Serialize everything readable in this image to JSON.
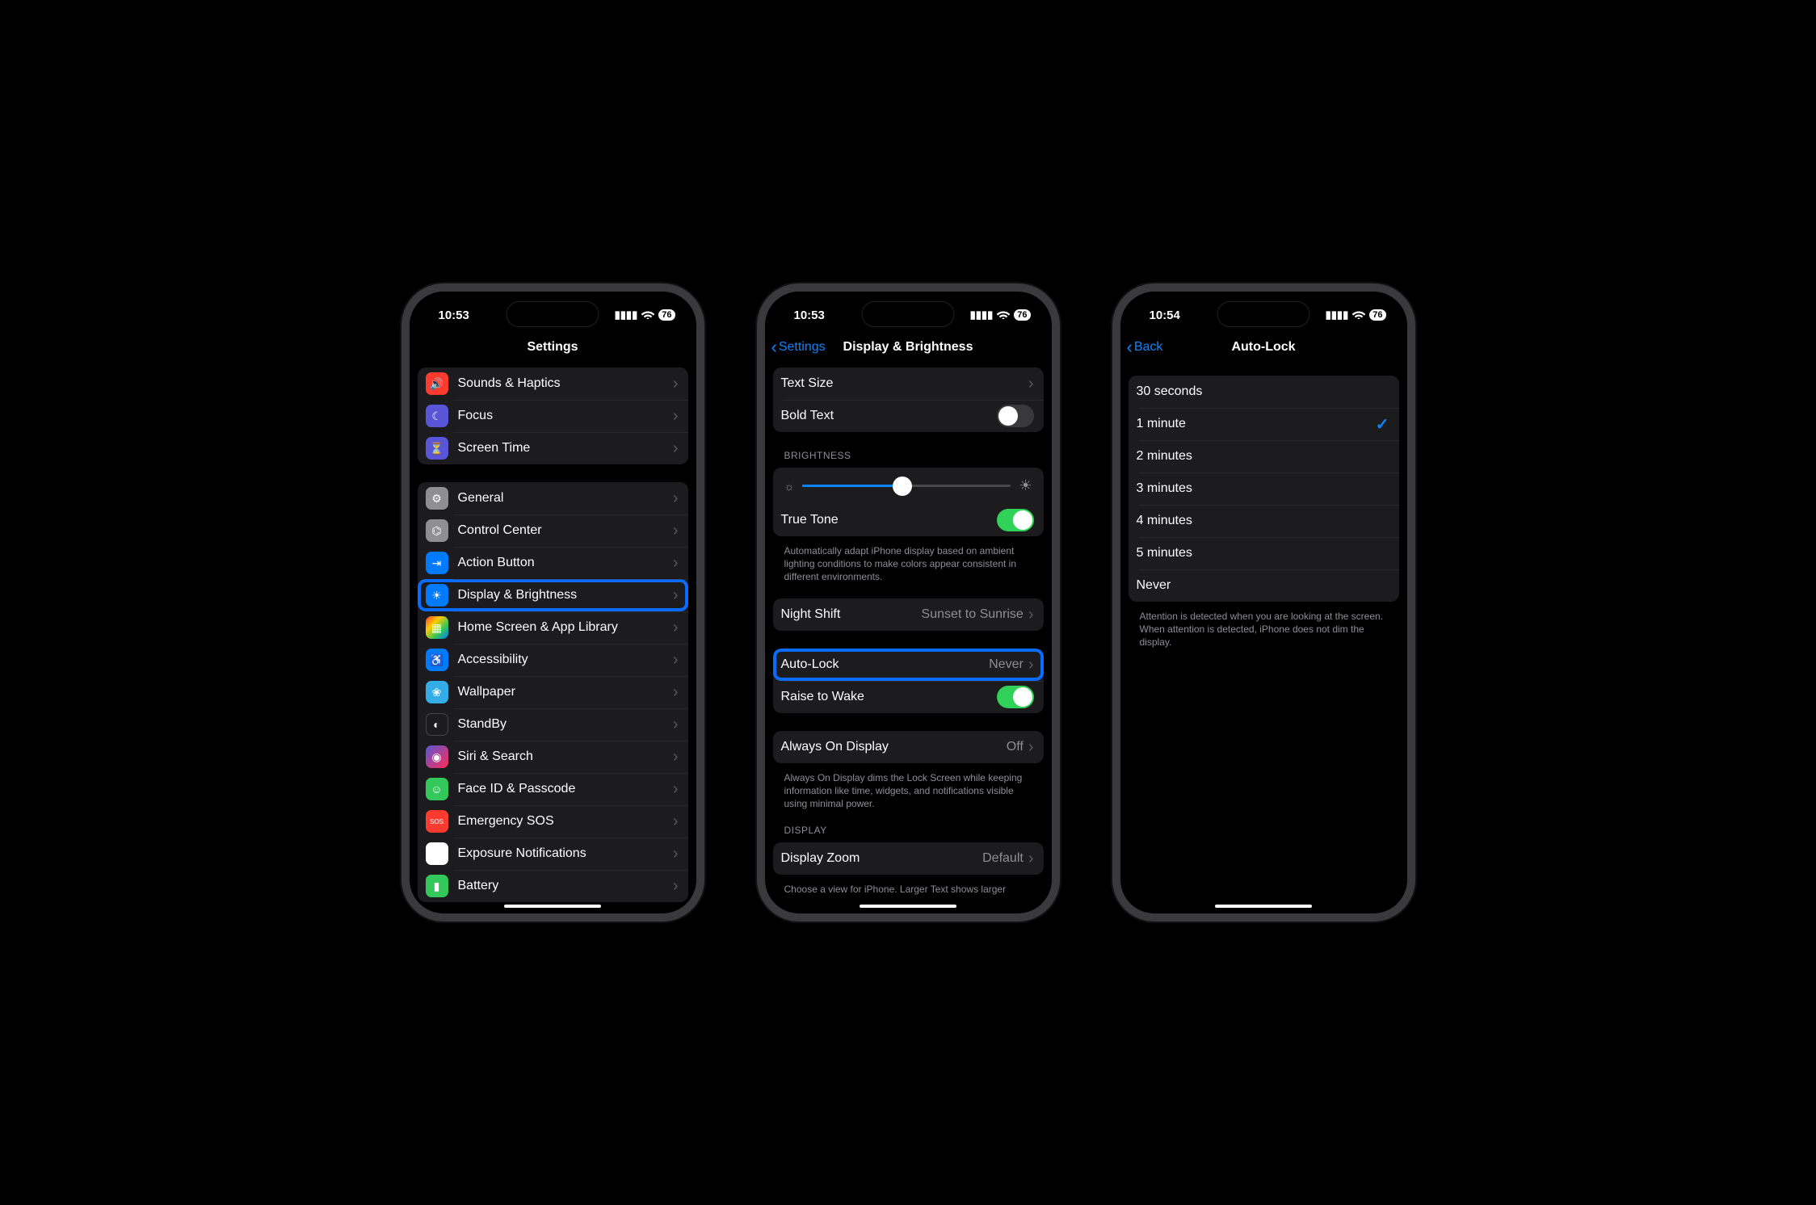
{
  "phone1": {
    "time": "10:53",
    "battery": "76",
    "title": "Settings",
    "group1": [
      {
        "label": "Sounds & Haptics",
        "icon": "speaker-icon",
        "color": "bg-red",
        "glyph": "🔊"
      },
      {
        "label": "Focus",
        "icon": "moon-icon",
        "color": "bg-purple",
        "glyph": "☾"
      },
      {
        "label": "Screen Time",
        "icon": "hourglass-icon",
        "color": "bg-purple",
        "glyph": "⏳"
      }
    ],
    "group2": [
      {
        "label": "General",
        "icon": "gear-icon",
        "color": "bg-gray",
        "glyph": "⚙"
      },
      {
        "label": "Control Center",
        "icon": "switches-icon",
        "color": "bg-gray",
        "glyph": "⌬"
      },
      {
        "label": "Action Button",
        "icon": "action-icon",
        "color": "bg-blue",
        "glyph": "⇥"
      },
      {
        "label": "Display & Brightness",
        "icon": "brightness-icon",
        "color": "bg-blue",
        "glyph": "☀",
        "highlight": true
      },
      {
        "label": "Home Screen & App Library",
        "icon": "grid-icon",
        "color": "bg-grid",
        "glyph": "▦"
      },
      {
        "label": "Accessibility",
        "icon": "accessibility-icon",
        "color": "bg-blue",
        "glyph": "♿"
      },
      {
        "label": "Wallpaper",
        "icon": "wallpaper-icon",
        "color": "bg-cyan",
        "glyph": "❀"
      },
      {
        "label": "StandBy",
        "icon": "standby-icon",
        "color": "bg-black",
        "glyph": "◐"
      },
      {
        "label": "Siri & Search",
        "icon": "siri-icon",
        "color": "bg-pink",
        "glyph": "◉"
      },
      {
        "label": "Face ID & Passcode",
        "icon": "faceid-icon",
        "color": "bg-green",
        "glyph": "☺"
      },
      {
        "label": "Emergency SOS",
        "icon": "sos-icon",
        "color": "bg-red",
        "glyph": "SOS"
      },
      {
        "label": "Exposure Notifications",
        "icon": "exposure-icon",
        "color": "bg-white",
        "glyph": "✲"
      },
      {
        "label": "Battery",
        "icon": "battery-icon",
        "color": "bg-green",
        "glyph": "▮"
      }
    ]
  },
  "phone2": {
    "time": "10:53",
    "battery": "76",
    "back": "Settings",
    "title": "Display & Brightness",
    "textSize": "Text Size",
    "boldText": "Bold Text",
    "brightnessHeader": "BRIGHTNESS",
    "trueTone": "True Tone",
    "trueToneFooter": "Automatically adapt iPhone display based on ambient lighting conditions to make colors appear consistent in different environments.",
    "nightShift": {
      "label": "Night Shift",
      "value": "Sunset to Sunrise"
    },
    "autoLock": {
      "label": "Auto-Lock",
      "value": "Never"
    },
    "raiseToWake": "Raise to Wake",
    "alwaysOn": {
      "label": "Always On Display",
      "value": "Off"
    },
    "alwaysOnFooter": "Always On Display dims the Lock Screen while keeping information like time, widgets, and notifications visible using minimal power.",
    "displayHeader": "DISPLAY",
    "displayZoom": {
      "label": "Display Zoom",
      "value": "Default"
    },
    "zoomFooter": "Choose a view for iPhone. Larger Text shows larger"
  },
  "phone3": {
    "time": "10:54",
    "battery": "76",
    "back": "Back",
    "title": "Auto-Lock",
    "options": [
      {
        "label": "30 seconds"
      },
      {
        "label": "1 minute",
        "checked": true
      },
      {
        "label": "2 minutes"
      },
      {
        "label": "3 minutes"
      },
      {
        "label": "4 minutes"
      },
      {
        "label": "5 minutes"
      },
      {
        "label": "Never"
      }
    ],
    "footer": "Attention is detected when you are looking at the screen. When attention is detected, iPhone does not dim the display."
  }
}
